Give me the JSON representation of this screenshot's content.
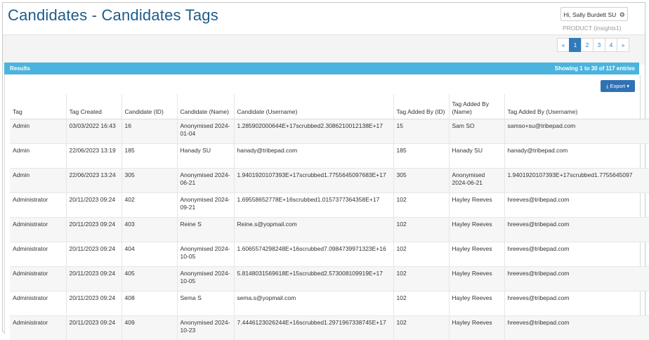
{
  "header": {
    "title": "Candidates - Candidates Tags",
    "user_greeting": "Hi, Sally Burdett SU",
    "gear_icon": "gear-icon",
    "product": "PRODUCT (insights1)"
  },
  "pagination": {
    "prev": "«",
    "pages": [
      "1",
      "2",
      "3",
      "4"
    ],
    "active": "1",
    "next": "»"
  },
  "results": {
    "label": "Results",
    "summary": "Showing 1 to 30 of 117 entries",
    "export_label": "Export ▾",
    "export_icon": "download-icon"
  },
  "colors": {
    "title": "#1d5c8a",
    "results_bar": "#4bb4de",
    "primary": "#2f72b4"
  },
  "table": {
    "columns": [
      "Tag",
      "Tag Created",
      "Candidate (ID)",
      "Candidate (Name)",
      "Candidate (Username)",
      "Tag Added By (ID)",
      "Tag Added By (Name)",
      "Tag Added By (Username)"
    ],
    "rows": [
      [
        "Admin",
        "03/03/2022 16:43",
        "16",
        "Anonymised 2024-01-04",
        "1.285902000644E+17scrubbed2.3086210012138E+17",
        "15",
        "Sam SO",
        "samso+su@tribepad.com"
      ],
      [
        "Admin",
        "22/06/2023 13:19",
        "185",
        "Hanady SU",
        "hanady@tribepad.com",
        "185",
        "Hanady SU",
        "hanady@tribepad.com"
      ],
      [
        "Admin",
        "22/06/2023 13:24",
        "305",
        "Anonymised 2024-06-21",
        "1.9401920107393E+17scrubbed1.7755645097683E+17",
        "305",
        "Anonymised 2024-06-21",
        "1.9401920107393E+17scrubbed1.7755645097"
      ],
      [
        "Administrator",
        "20/11/2023 09:24",
        "402",
        "Anonymised 2024-09-21",
        "1.69558652778E+16scrubbed1.0157377364358E+17",
        "102",
        "Hayley Reeves",
        "hreeves@tribepad.com"
      ],
      [
        "Administrator",
        "20/11/2023 09:24",
        "403",
        "Reine S",
        "Reine.s@yopmail.com",
        "102",
        "Hayley Reeves",
        "hreeves@tribepad.com"
      ],
      [
        "Administrator",
        "20/11/2023 09:24",
        "404",
        "Anonymised 2024-10-05",
        "1.6065574298248E+16scrubbed7.0984739971323E+16",
        "102",
        "Hayley Reeves",
        "hreeves@tribepad.com"
      ],
      [
        "Administrator",
        "20/11/2023 09:24",
        "405",
        "Anonymised 2024-10-05",
        "5.8148031569618E+15scrubbed2.573008109919E+17",
        "102",
        "Hayley Reeves",
        "hreeves@tribepad.com"
      ],
      [
        "Administrator",
        "20/11/2023 09:24",
        "408",
        "Sema S",
        "sema.s@yopmail.com",
        "102",
        "Hayley Reeves",
        "hreeves@tribepad.com"
      ],
      [
        "Administrator",
        "20/11/2023 09:24",
        "409",
        "Anonymised 2024-10-23",
        "7.4446123026244E+16scrubbed1.2971967338745E+17",
        "102",
        "Hayley Reeves",
        "hreeves@tribepad.com"
      ]
    ]
  }
}
